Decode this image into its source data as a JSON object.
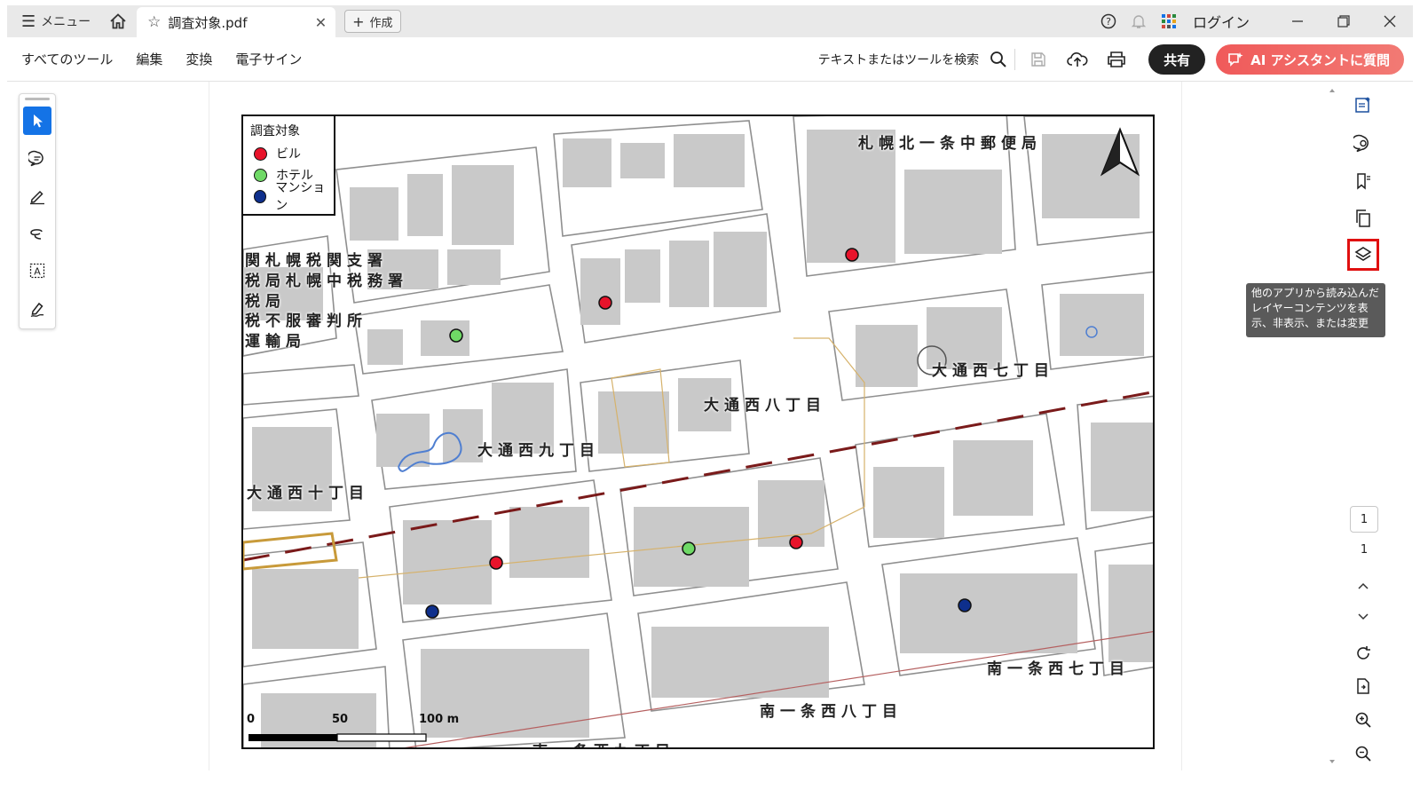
{
  "titlebar": {
    "menu_label": "メニュー",
    "tab_title": "調査対象.pdf",
    "new_label": "作成",
    "login_label": "ログイン"
  },
  "toolbar": {
    "menus": [
      "すべてのツール",
      "編集",
      "変換",
      "電子サイン"
    ],
    "search_label": "テキストまたはツールを検索",
    "share_label": "共有",
    "ai_label": "AI アシスタントに質問"
  },
  "left_tools": [
    "select-tool",
    "comment-tool",
    "highlight-tool",
    "lasso-tool",
    "text-recognition-tool",
    "sign-tool"
  ],
  "legend": {
    "title": "調査対象",
    "items": [
      {
        "label": "ビル",
        "color": "#e8132b"
      },
      {
        "label": "ホテル",
        "color": "#6fd966"
      },
      {
        "label": "マンション",
        "color": "#0e2f8c"
      }
    ]
  },
  "map": {
    "labels": {
      "post_office": "札幌北一条中郵便局",
      "tax_1": "関札幌税関支署",
      "tax_2": "税局札幌中税務署",
      "tax_3": "税局",
      "tax_4": "税不服審判所",
      "tax_5": "運輸局",
      "nishi7": "大通西七丁目",
      "nishi8": "大通西八丁目",
      "nishi9": "大通西九丁目",
      "nishi10": "大通西十丁目",
      "minami_nishi7": "南一条西七丁目",
      "minami_nishi8": "南一条西八丁目",
      "minami_nishi9": "南一条西九丁目"
    },
    "scale": {
      "zero": "0",
      "mid": "50",
      "max": "100 m"
    },
    "points": [
      {
        "type": "ビル"
      },
      {
        "type": "ビル"
      },
      {
        "type": "ビル"
      },
      {
        "type": "ビル"
      },
      {
        "type": "ホテル"
      },
      {
        "type": "ホテル"
      },
      {
        "type": "マンション"
      },
      {
        "type": "マンション"
      }
    ]
  },
  "right_panel": {
    "tooltip": "他のアプリから読み込んだレイヤーコンテンツを表示、非表示、または変更",
    "page_current": "1",
    "page_total": "1"
  },
  "colors": {
    "accent": "#1473e6",
    "ai_button": "#f05a5a",
    "highlight_border": "#e01010",
    "building": "#c9c9c9",
    "tram_line": "#7a1a1a"
  }
}
